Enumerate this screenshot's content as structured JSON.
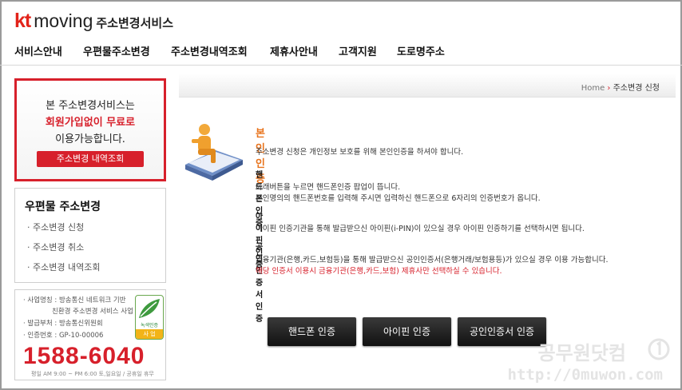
{
  "header": {
    "brand_kt": "kt",
    "brand_moving": "moving",
    "brand_service": "주소변경서비스"
  },
  "nav": [
    "서비스안내",
    "우편물주소변경",
    "주소변경내역조회",
    "제휴사안내",
    "고객지원",
    "도로명주소"
  ],
  "promo": {
    "line1": "본 주소변경서비스는",
    "line2": "회원가입없이 무료로",
    "line3": "이용가능합니다.",
    "button": "주소변경 내역조회"
  },
  "submenu": {
    "title": "우편물 주소변경",
    "items": [
      "· 주소변경 신청",
      "· 주소변경 취소",
      "· 주소변경 내역조회"
    ]
  },
  "info": {
    "rows": [
      "· 사업명칭 : 방송통신 네트워크 기반",
      "친환경 주소변경 서비스 사업",
      "· 발급부처 : 방송통신위원회",
      "· 인증번호 : GP-10-00006"
    ],
    "phone": "1588-6040",
    "hours": "평일 AM 9:00 ~ PM 6:00 토,일요일 / 공휴일 휴무",
    "cert_label": "녹색인증",
    "cert_sub": "사 업"
  },
  "breadcrumb": {
    "home": "Home",
    "sep": "›",
    "current": "주소변경 신청"
  },
  "content": {
    "title": "본인인증",
    "intro": "주소변경 신청은 개인정보 보호를 위해 본인인증을 하셔야 합니다.",
    "sections": [
      {
        "heading": "핸드폰인증",
        "lines": [
          "아래버튼을 누르면 핸드폰인증 팝업이 뜹니다.",
          "본인명의의 핸드폰번호를 입력해 주시면 입력하신 핸드폰으로 6자리의 인증번호가 옵니다."
        ]
      },
      {
        "heading": "아이핀인증",
        "lines": [
          "아이핀 인증기관을 통해 발급받으신 아이핀(i-PIN)이 있으실 경우 아이핀 인증하기를 선택하시면 됩니다."
        ]
      },
      {
        "heading": "공인인증서인증",
        "lines": [
          "금융기관(은행,카드,보험등)을 통해 발급받으신 공인인증서(은행거래/보험용등)가 있으실 경우 이용 가능합니다."
        ],
        "warning": "해당 인증서 이용시  금융기관(은행,카드,보험) 제휴사만 선택하실 수  있습니다."
      }
    ]
  },
  "buttons": {
    "phone": "핸드폰 인증",
    "ipin": "아이핀 인증",
    "cert": "공인인증서 인증"
  },
  "watermark": {
    "name": "공무원닷컴",
    "url": "http://0muwon.com"
  },
  "colors": {
    "accent_red": "#d7202b",
    "title_orange": "#e8731c"
  }
}
